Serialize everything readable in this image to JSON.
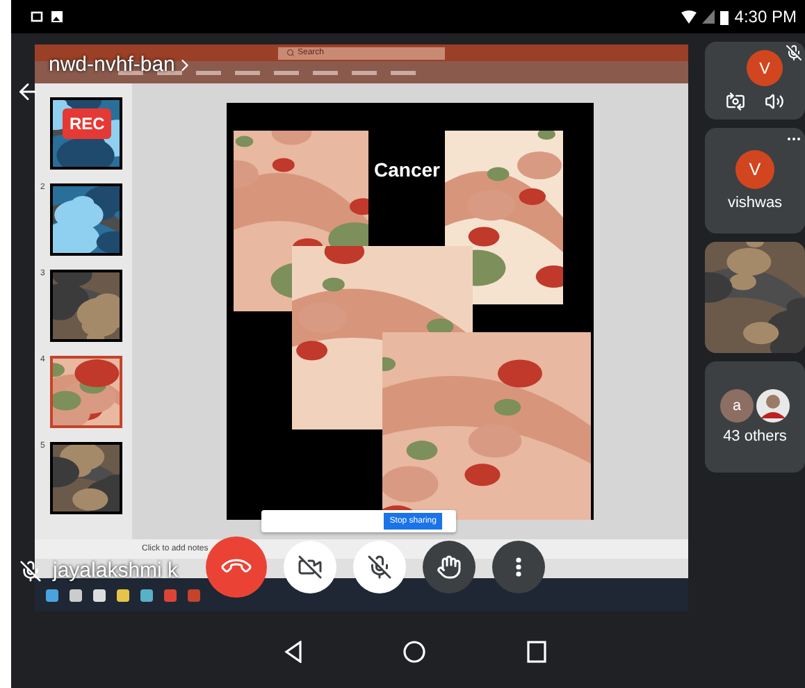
{
  "status_bar": {
    "time": "4:30 PM"
  },
  "meeting": {
    "code": "nwd-nvhf-ban",
    "recording_badge": "REC"
  },
  "shared_screen": {
    "search": "Search",
    "slide_title": "Cancer",
    "notes_placeholder": "Click to add notes",
    "stop_sharing": "Stop sharing",
    "thumbnails": [
      {
        "selected": false
      },
      {
        "number": "2",
        "selected": false
      },
      {
        "number": "3",
        "selected": false
      },
      {
        "number": "4",
        "selected": true
      },
      {
        "number": "5",
        "selected": false
      }
    ]
  },
  "presenter": {
    "name": "jayalakshmi k",
    "muted": true
  },
  "controls": [
    {
      "kind": "end-call"
    },
    {
      "kind": "camera",
      "on": false
    },
    {
      "kind": "mic",
      "on": false
    },
    {
      "kind": "hand"
    },
    {
      "kind": "more"
    }
  ],
  "participants": [
    {
      "kind": "self",
      "initial": "V",
      "muted": true
    },
    {
      "kind": "avatar",
      "initial": "V",
      "name": "vishwas"
    },
    {
      "kind": "video"
    },
    {
      "kind": "others",
      "initial": "a",
      "label": "43 others"
    }
  ]
}
